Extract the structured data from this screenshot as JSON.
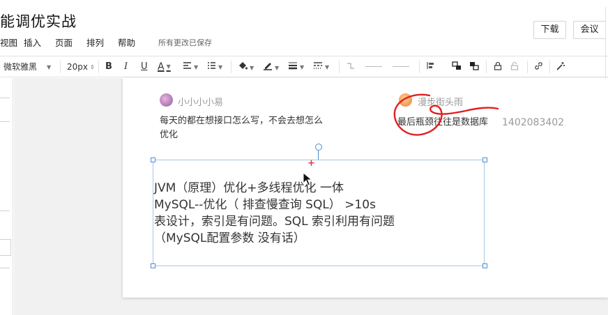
{
  "title": "能调优实战",
  "menu": [
    "视图",
    "插入",
    "页面",
    "排列",
    "帮助"
  ],
  "save_status": "所有更改已保存",
  "buttons": {
    "download": "下载",
    "meeting": "会议"
  },
  "toolbar": {
    "font_family": "微软雅黑",
    "font_size": "20px",
    "bold": "B",
    "italic": "I",
    "underline": "U",
    "font_color": "A"
  },
  "icons": [
    "text-align-icon",
    "list-icon",
    "fill-bucket-icon",
    "pen-color-icon",
    "line-weight-icon",
    "line-style-icon",
    "connector-icon",
    "align-icon",
    "bring-front-icon",
    "send-back-icon",
    "lock-icon",
    "unlock-icon",
    "link-icon",
    "magic-wand-icon"
  ],
  "chat": {
    "left": {
      "user": "小小小小易",
      "message_lines": [
        "每天的都在想接口怎么写，不会去想怎么",
        "优化"
      ]
    },
    "right": {
      "user": "漫步街头雨",
      "message": "最后瓶颈往往是数据库",
      "id_text": "1402083402"
    }
  },
  "note": {
    "lines": [
      "JVM（原理）优化+多线程优化 一体",
      "MySQL--优化（ 排查慢查询 SQL） >10s",
      "表设计，索引是有问题。SQL 索引利用有问题",
      "（MySQL配置参数 没有话）"
    ]
  },
  "colors": {
    "annotation": "#e02020",
    "selection": "#4d8bd1",
    "canvas": "#f1f1f1"
  }
}
